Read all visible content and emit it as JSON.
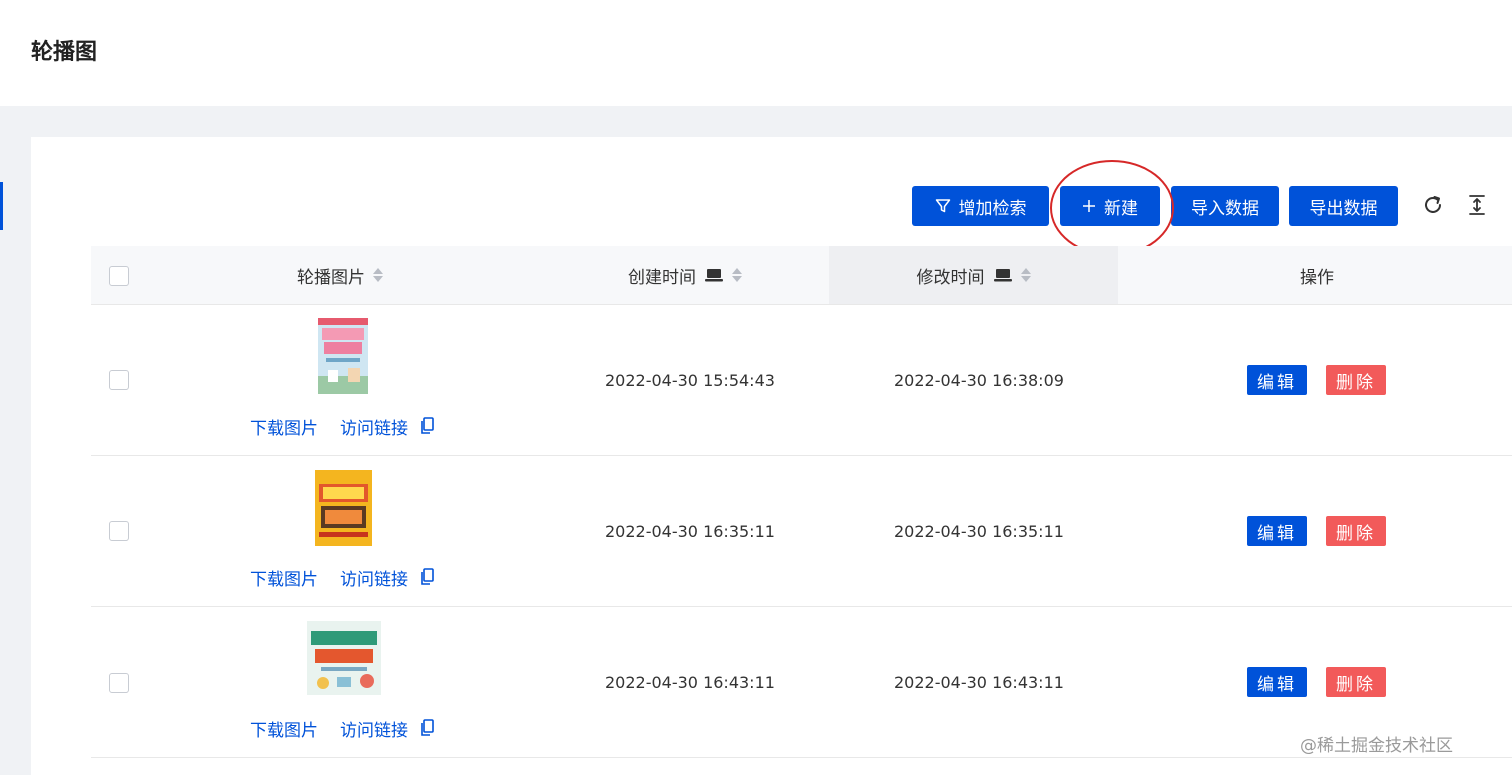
{
  "page": {
    "title": "轮播图"
  },
  "toolbar": {
    "add_search": "增加检索",
    "create": "新建",
    "import": "导入数据",
    "export": "导出数据",
    "refresh_icon": "refresh-icon",
    "density_icon": "column-height-icon"
  },
  "table": {
    "columns": [
      "轮播图片",
      "创建时间",
      "修改时间",
      "操作"
    ],
    "rows": [
      {
        "created": "2022-04-30 15:54:43",
        "modified": "2022-04-30 16:38:09",
        "download": "下载图片",
        "visit": "访问链接"
      },
      {
        "created": "2022-04-30 16:35:11",
        "modified": "2022-04-30 16:35:11",
        "download": "下载图片",
        "visit": "访问链接"
      },
      {
        "created": "2022-04-30 16:43:11",
        "modified": "2022-04-30 16:43:11",
        "download": "下载图片",
        "visit": "访问链接"
      }
    ],
    "actions": {
      "edit": "编辑",
      "delete": "删除"
    }
  },
  "colors": {
    "primary": "#0052d9",
    "danger": "#f25a5a",
    "annotation": "#d62828"
  },
  "watermark": "@稀土掘金技术社区"
}
